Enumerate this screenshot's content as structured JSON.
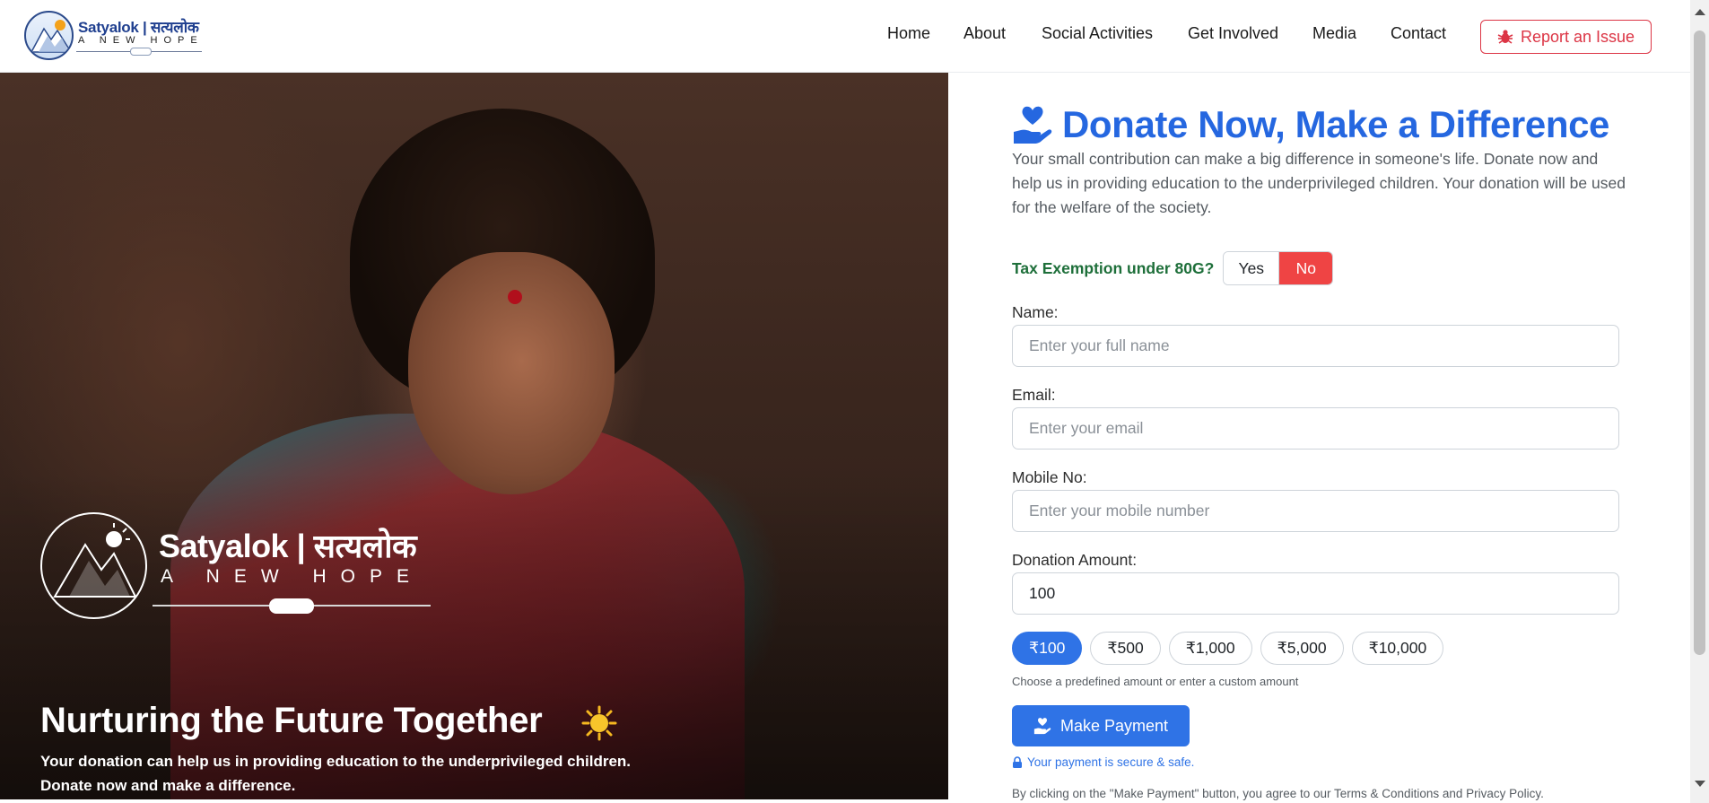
{
  "header": {
    "logo": {
      "name": "Satyalok | सत्यलोक",
      "tagline": "A NEW HOPE",
      "icon": "mountain-emblem-icon"
    },
    "nav": [
      "Home",
      "About",
      "Social Activities",
      "Get Involved",
      "Media",
      "Contact"
    ],
    "report_button": {
      "label": "Report an Issue",
      "icon": "bug-icon"
    }
  },
  "hero": {
    "logo": {
      "name": "Satyalok | सत्यलोक",
      "tagline": "A NEW HOPE"
    },
    "title": "Nurturing the Future Together",
    "title_icon": "sun-emoji-icon",
    "subtitle_line1": "Your donation can help us in providing education to the underprivileged children.",
    "subtitle_line2": "Donate now and make a difference."
  },
  "donate": {
    "title": "Donate Now, Make a Difference",
    "title_icon": "hand-holding-heart-icon",
    "intro": "Your small contribution can make a big difference in someone's life. Donate now and help us in providing education to the underprivileged children. Your donation will be used for the welfare of the society.",
    "tax_label": "Tax Exemption under 80G?",
    "tax_yes": "Yes",
    "tax_no": "No",
    "tax_selected": "No",
    "name_label": "Name:",
    "name_placeholder": "Enter your full name",
    "email_label": "Email:",
    "email_placeholder": "Enter your email",
    "mobile_label": "Mobile No:",
    "mobile_placeholder": "Enter your mobile number",
    "amount_label": "Donation Amount:",
    "amount_value": "100",
    "amount_options": [
      "₹100",
      "₹500",
      "₹1,000",
      "₹5,000",
      "₹10,000"
    ],
    "amount_selected": "₹100",
    "amount_hint": "Choose a predefined amount or enter a custom amount",
    "pay_button": "Make Payment",
    "secure_text": "Your payment is secure & safe.",
    "terms_text": "By clicking on the \"Make Payment\" button, you agree to our Terms & Conditions and Privacy Policy."
  },
  "colors": {
    "primary": "#2f73e6",
    "title_blue": "#2567e0",
    "danger": "#dc3545",
    "tax_green": "#1e6f3a",
    "no_selected": "#ef4444"
  }
}
